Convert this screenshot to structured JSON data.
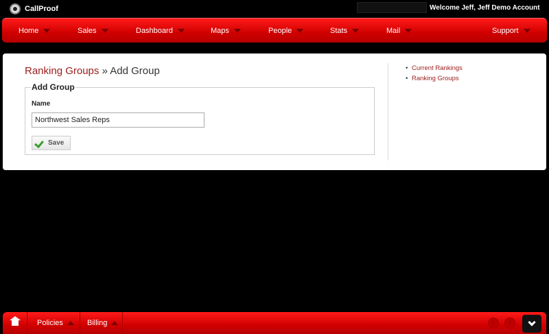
{
  "app": {
    "name": "CallProof",
    "welcome": "Welcome Jeff, Jeff Demo Account"
  },
  "nav": {
    "items": [
      {
        "label": "Home"
      },
      {
        "label": "Sales"
      },
      {
        "label": "Dashboard"
      },
      {
        "label": "Maps"
      },
      {
        "label": "People"
      },
      {
        "label": "Stats"
      },
      {
        "label": "Mail"
      },
      {
        "label": "Support"
      }
    ]
  },
  "breadcrumb": {
    "parent": "Ranking Groups",
    "separator": "»",
    "current": "Add Group"
  },
  "form": {
    "legend": "Add Group",
    "name_label": "Name",
    "name_value": "Northwest Sales Reps",
    "save_label": "Save"
  },
  "sidebar": {
    "links": [
      {
        "label": "Current Rankings"
      },
      {
        "label": "Ranking Groups"
      }
    ]
  },
  "footer": {
    "items": [
      {
        "label": "Policies"
      },
      {
        "label": "Billing"
      }
    ],
    "social": [
      {
        "icon": "twitter-icon",
        "glyph": "t"
      },
      {
        "icon": "facebook-icon",
        "glyph": "f"
      }
    ]
  },
  "colors": {
    "brand_red": "#d00000",
    "link_red": "#9b1b1b"
  }
}
